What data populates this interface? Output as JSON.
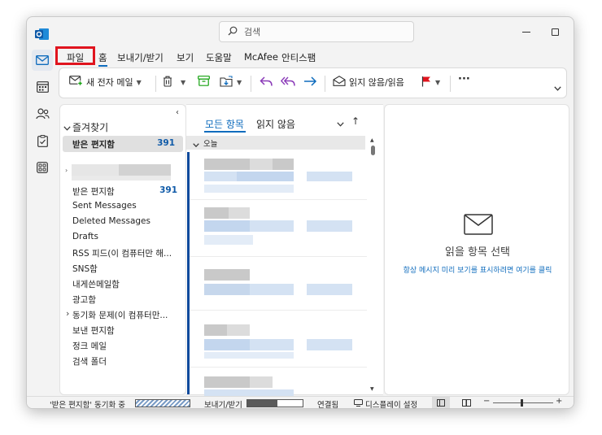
{
  "title_bar": {
    "search_placeholder": "검색"
  },
  "menu": {
    "items": [
      "파일",
      "홈",
      "보내기/받기",
      "보기",
      "도움말",
      "McAfee",
      "안티스팸"
    ],
    "highlight_color": "#e0141e"
  },
  "ribbon": {
    "new_mail_label": "새 전자 메일",
    "read_unread_label": "읽지 않음/읽음",
    "more_label": "···"
  },
  "folder_pane": {
    "favorites_label": "즐겨찾기",
    "favorite_inbox": {
      "label": "받은 편지함",
      "count": "391"
    },
    "account_items": [
      {
        "label": "받은 편지함",
        "count": "391"
      },
      {
        "label": "Sent Messages"
      },
      {
        "label": "Deleted Messages"
      },
      {
        "label": "Drafts"
      },
      {
        "label": "RSS 피드(이 컴퓨터만 해..."
      },
      {
        "label": "SNS함"
      },
      {
        "label": "내게쓴메일함"
      },
      {
        "label": "광고함"
      },
      {
        "label": "동기화 문제(이 컴퓨터만..."
      },
      {
        "label": "보낸 편지함"
      },
      {
        "label": "정크 메일"
      },
      {
        "label": "검색 폴더"
      }
    ]
  },
  "message_list": {
    "tab_all": "모든 항목",
    "tab_unread": "읽지 않음",
    "group_today": "오늘"
  },
  "reading_pane": {
    "title": "읽을 항목 선택",
    "link": "항상 메시지 미리 보기를 표시하려면 여기를 클릭"
  },
  "status_bar": {
    "sync_text": "'받은 편지함' 동기화 중",
    "send_receive": "보내기/받기",
    "connected": "연결됨",
    "display_settings": "디스플레이 설정",
    "progress_fraction": 0.55
  },
  "colors": {
    "accent": "#0f6cbd",
    "unread_bar": "#0f4a9c"
  }
}
